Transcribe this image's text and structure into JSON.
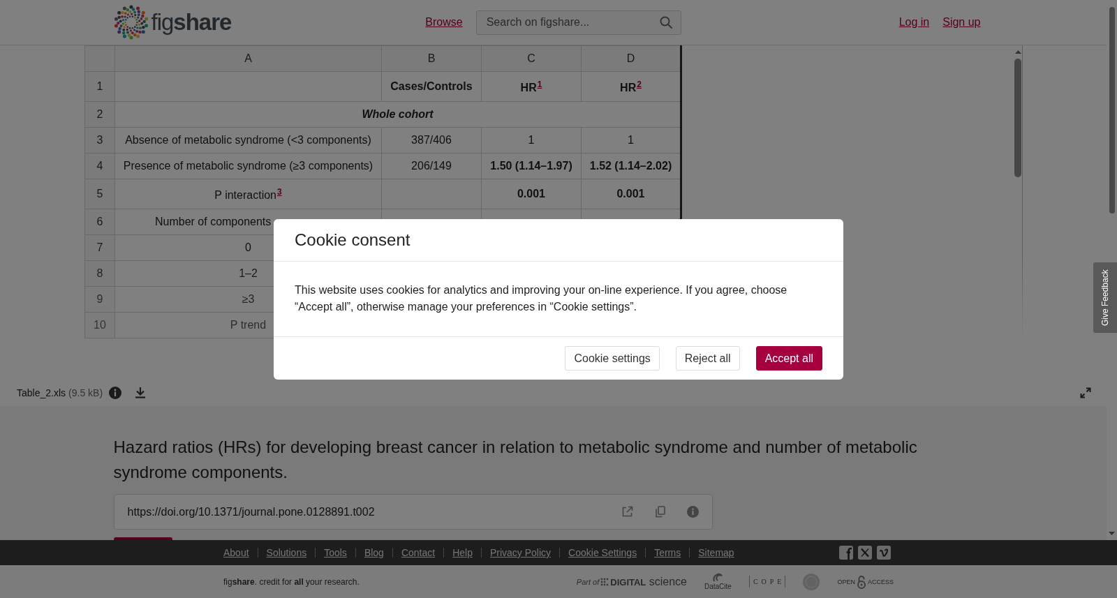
{
  "header": {
    "logo_text": "fig**share**",
    "browse": "Browse",
    "search": {
      "placeholder": "Search on figshare..."
    },
    "account_links": [
      "Log in",
      "Sign up"
    ]
  },
  "viewer": {
    "columns": [
      "A",
      "B",
      "C",
      "D"
    ],
    "rows": [
      {
        "number": "1",
        "kind": "data",
        "cells": [
          {
            "kind": "empty"
          },
          {
            "kind": "text",
            "text": "Cases/Controls",
            "bold": true
          },
          {
            "kind": "text",
            "text": "HR",
            "bold": true,
            "footnote": "1"
          },
          {
            "kind": "text",
            "text": "HR",
            "bold": true,
            "footnote": "2"
          }
        ]
      },
      {
        "number": "2",
        "kind": "section",
        "cells": [
          {
            "kind": "text",
            "text": "Whole cohort",
            "bold": true,
            "colspan": 4
          }
        ]
      },
      {
        "number": "3",
        "kind": "data",
        "cells": [
          {
            "kind": "text",
            "text": "Absence of metabolic syndrome (<3 components)",
            "bold": false
          },
          {
            "kind": "text",
            "text": "387/406",
            "bold": false
          },
          {
            "kind": "text",
            "text": "1",
            "bold": false
          },
          {
            "kind": "text",
            "text": "1",
            "bold": false
          }
        ]
      },
      {
        "number": "4",
        "kind": "data",
        "cells": [
          {
            "kind": "text",
            "text": "Presence of metabolic syndrome (≥3 components)",
            "bold": false
          },
          {
            "kind": "text",
            "text": "206/149",
            "bold": false
          },
          {
            "kind": "text",
            "text": "1.50 (1.14–1.97)",
            "bold": true
          },
          {
            "kind": "text",
            "text": "1.52 (1.14–2.02)",
            "bold": true
          }
        ]
      },
      {
        "number": "5",
        "kind": "data",
        "cells": [
          {
            "kind": "text",
            "text": "P interaction",
            "bold": false,
            "footnote": "3"
          },
          {
            "kind": "empty"
          },
          {
            "kind": "text",
            "text": "0.001",
            "bold": true
          },
          {
            "kind": "text",
            "text": "0.001",
            "bold": true
          }
        ]
      },
      {
        "number": "6",
        "kind": "data",
        "cells": [
          {
            "kind": "clipped",
            "text": "Number of components",
            "bold": false
          }
        ]
      },
      {
        "number": "7",
        "kind": "data",
        "cells": [
          {
            "kind": "text",
            "text": "0",
            "bold": false
          }
        ]
      },
      {
        "number": "8",
        "kind": "data",
        "cells": [
          {
            "kind": "text",
            "text": "1–2",
            "bold": false
          }
        ]
      },
      {
        "number": "9",
        "kind": "data",
        "cells": [
          {
            "kind": "text",
            "text": "≥3",
            "bold": false
          }
        ]
      },
      {
        "number": "10",
        "kind": "data",
        "cells": [
          {
            "kind": "text",
            "text": "P trend",
            "bold": false
          }
        ]
      }
    ]
  },
  "file": {
    "name": "Table_2.xls",
    "size": "(9.5 kB)"
  },
  "item": {
    "title": "Hazard ratios (HRs) for developing breast cancer in relation to metabolic syndrome and number of metabolic syndrome components.",
    "doi": "https://doi.org/10.1371/journal.pone.0128891.t002"
  },
  "footer": {
    "links": [
      "About",
      "Solutions",
      "Tools",
      "Blog",
      "Contact",
      "Help",
      "Privacy Policy",
      "Cookie Settings",
      "Terms",
      "Sitemap"
    ],
    "social": [
      {
        "kind": "facebook"
      },
      {
        "kind": "x"
      },
      {
        "kind": "vimeo"
      }
    ],
    "tagline": "fig**share**. credit for **all** your research.",
    "partners": [
      {
        "kind": "digital-science",
        "prefix": "Part of",
        "name": "**DIGITAL** science"
      },
      {
        "kind": "datacite",
        "name": "DataCite"
      },
      {
        "kind": "cope",
        "name": "COPE"
      },
      {
        "kind": "seal"
      },
      {
        "kind": "open-access",
        "words": [
          "OPEN",
          "ACCESS"
        ]
      }
    ]
  },
  "feedback": {
    "label": "Give Feedback"
  },
  "cookie_dialog": {
    "title": "Cookie consent",
    "text": "This website uses cookies for analytics and improving your on-line experience. If you agree, choose “Accept all”, otherwise manage your preferences in “Cookie settings”.",
    "buttons": [
      {
        "label": "Cookie settings",
        "kind": "secondary"
      },
      {
        "label": "Reject all",
        "kind": "secondary"
      },
      {
        "label": "Accept all",
        "kind": "primary"
      }
    ]
  }
}
